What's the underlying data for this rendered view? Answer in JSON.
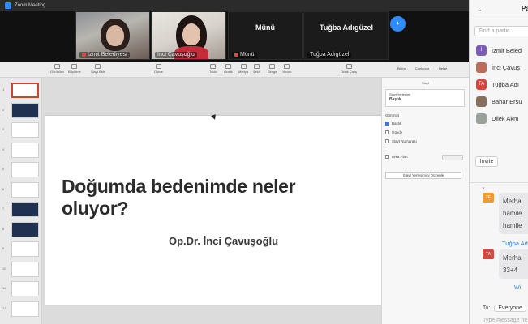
{
  "window": {
    "title": "Zoom Meeting"
  },
  "videos": [
    {
      "name": "İzmit Belediyesi",
      "muted": true
    },
    {
      "name": "İnci Çavuşoğlu",
      "muted": false
    },
    {
      "name": "Münü",
      "label": "Münü",
      "muted": true
    },
    {
      "name": "Tuğba Adıgüzel",
      "label": "Tuğba Adıgüzel",
      "muted": false
    }
  ],
  "ribbon": {
    "buttons": [
      "Slayt",
      "Yeni",
      "Tablo",
      "Grafik",
      "Medya",
      "Şekil",
      "Simge",
      "Yorum",
      "Ortak Çalış"
    ],
    "right_tabs": [
      "Biçim",
      "Canlandır",
      "Belge"
    ],
    "small_labels": [
      "Görünüm",
      "Büyütme",
      "Slayt Ekle",
      "Oynat"
    ]
  },
  "slide": {
    "title": "Doğumda bedenimde neler oluyor?",
    "subtitle": "Op.Dr. İnci Çavuşoğlu"
  },
  "design_pane": {
    "header": "Slayt",
    "size_label": "Slayt Yerleşimi",
    "size_value": "Başlık",
    "section_label": "Görünüş",
    "checks": [
      {
        "label": "Başlık",
        "checked": true
      },
      {
        "label": "Gövde",
        "checked": false
      },
      {
        "label": "Slayt Numarası",
        "checked": false
      }
    ],
    "background_label": "Arka Plan",
    "edit_button": "Slayt Yerleşimini Düzenle"
  },
  "thumbnails": [
    {
      "num": "1",
      "dark": false,
      "active": true
    },
    {
      "num": "2",
      "dark": true,
      "active": false
    },
    {
      "num": "3",
      "dark": false,
      "active": false
    },
    {
      "num": "4",
      "dark": false,
      "active": false
    },
    {
      "num": "5",
      "dark": false,
      "active": false
    },
    {
      "num": "6",
      "dark": false,
      "active": false
    },
    {
      "num": "7",
      "dark": true,
      "active": false
    },
    {
      "num": "8",
      "dark": true,
      "active": false
    },
    {
      "num": "9",
      "dark": false,
      "active": false
    },
    {
      "num": "10",
      "dark": false,
      "active": false
    },
    {
      "num": "11",
      "dark": false,
      "active": false
    },
    {
      "num": "12",
      "dark": false,
      "active": false
    }
  ],
  "participants_panel": {
    "title": "Pa",
    "search_placeholder": "Find a partic",
    "items": [
      {
        "initials": "İ",
        "color": "#7b5ab8",
        "name": "İzmit Beled"
      },
      {
        "initials": "",
        "color": "#c06a5a",
        "name": "İnci Çavuş"
      },
      {
        "initials": "TA",
        "color": "#d9453a",
        "name": "Tuğba Adı"
      },
      {
        "initials": "",
        "color": "#8a6e5c",
        "name": "Bahar Ersu"
      },
      {
        "initials": "",
        "color": "#9aa19a",
        "name": "Dilek Akm"
      }
    ],
    "invite_label": "Invite"
  },
  "chat": {
    "messages": [
      {
        "initials": "2E",
        "color": "#f29a2b",
        "lines": [
          "Merha",
          "hamile",
          "hamile"
        ]
      },
      {
        "initials": "TA",
        "color": "#d9453a",
        "lines": [
          "Merha",
          "33+4"
        ]
      }
    ],
    "sender_label": "Tuğba Ad",
    "with_label": "Wi",
    "to_label": "To:",
    "to_value": "Everyone",
    "input_placeholder": "Type message he"
  }
}
